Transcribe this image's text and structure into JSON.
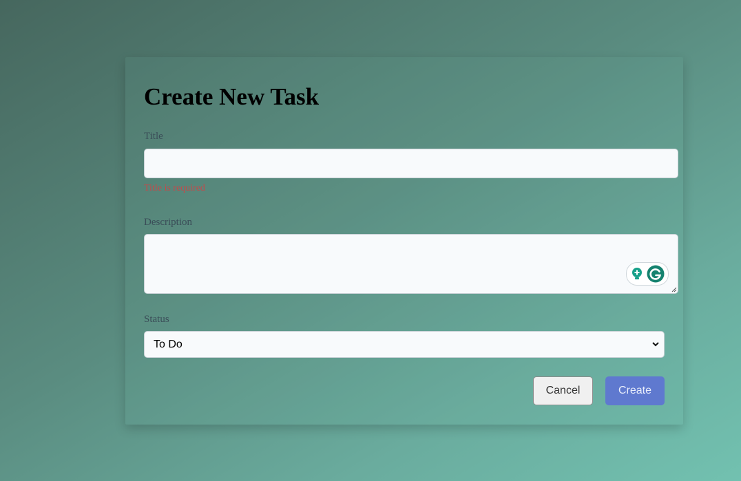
{
  "form": {
    "title": "Create New Task",
    "title_label": "Title",
    "title_value": "",
    "title_error": "Title is required",
    "description_label": "Description",
    "description_value": "",
    "status_label": "Status",
    "status_value": "To Do",
    "cancel_label": "Cancel",
    "create_label": "Create"
  },
  "icons": {
    "grammarly_suggestion": "lightbulb-icon",
    "grammarly": "grammarly-g-icon",
    "select_arrow": "chevron-down-icon",
    "resize": "resize-handle-icon"
  },
  "colors": {
    "error": "#c24a4a",
    "primary_button": "#5f79cf",
    "grammarly": "#15a089"
  }
}
